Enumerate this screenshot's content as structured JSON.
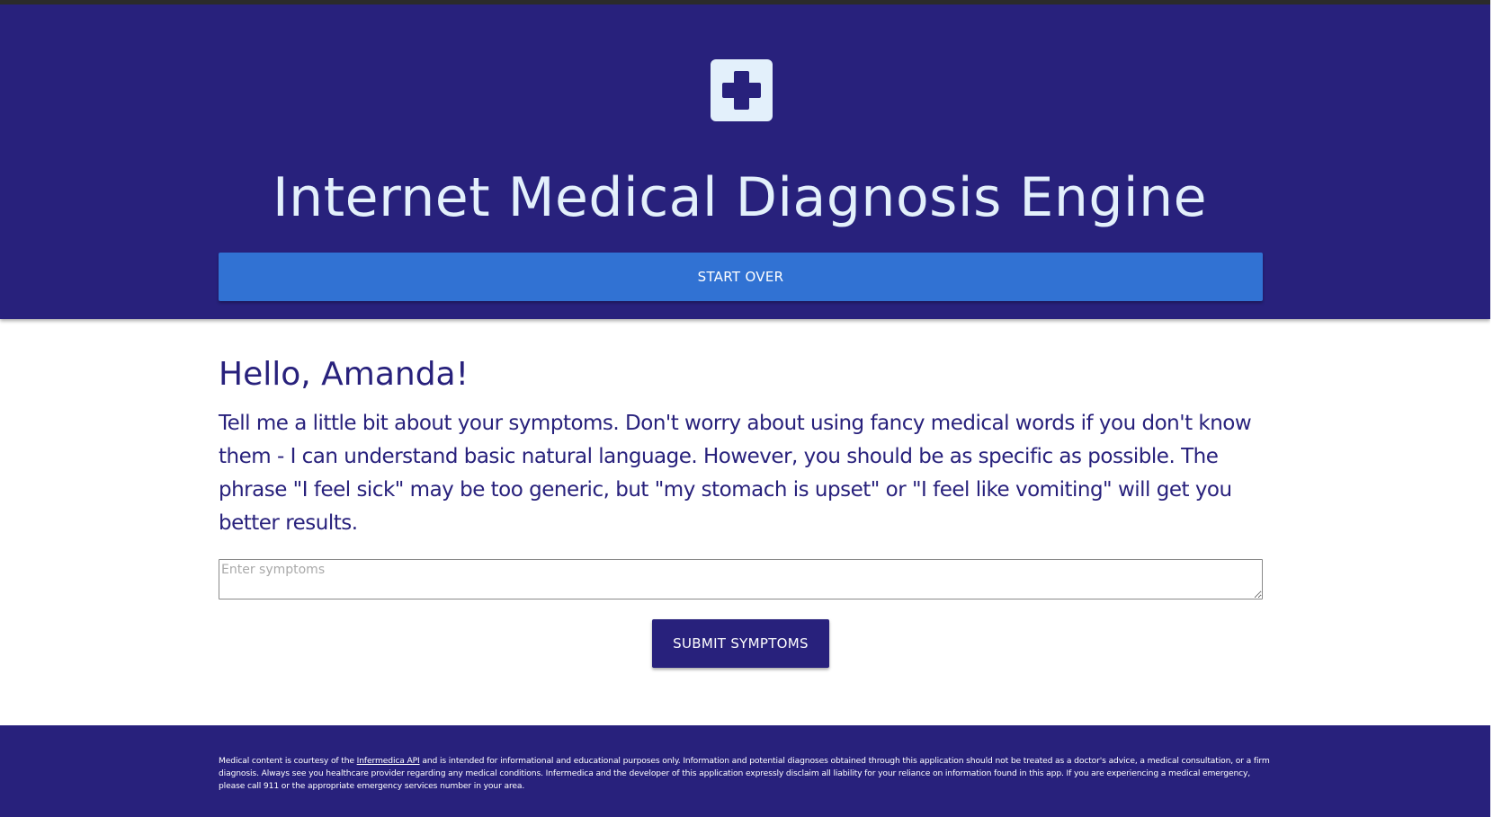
{
  "header": {
    "logo_icon": "medical-cross-icon",
    "title": "Internet Medical Diagnosis Engine",
    "start_over_label": "START OVER"
  },
  "main": {
    "greeting": "Hello, Amanda!",
    "instructions": "Tell me a little bit about your symptoms. Don't worry about using fancy medical words if you don't know them - I can understand basic natural language. However, you should be as specific as possible. The phrase \"I feel sick\" may be too generic, but \"my stomach is upset\" or \"I feel like vomiting\" will get you better results.",
    "symptoms_input": {
      "value": "",
      "placeholder": "Enter symptoms"
    },
    "submit_label": "SUBMIT SYMPTOMS"
  },
  "footer": {
    "disclaimer_prefix": "Medical content is courtesy of the ",
    "disclaimer_link": "Infermedica API",
    "disclaimer_suffix": " and is intended for informational and educational purposes only. Information and potential diagnoses obtained through this application should not be treated as a doctor's advice, a medical consultation, or a firm diagnosis. Always see you healthcare provider regarding any medical conditions. Infermedica and the developer of this application expressly disclaim all liability for your reliance on information found in this app. If you are experiencing a medical emergency, please call 911 or the appropriate emergency services number in your area."
  },
  "colors": {
    "primary": "#28217c",
    "accent": "#3172d3",
    "light": "#e3f0fb"
  }
}
